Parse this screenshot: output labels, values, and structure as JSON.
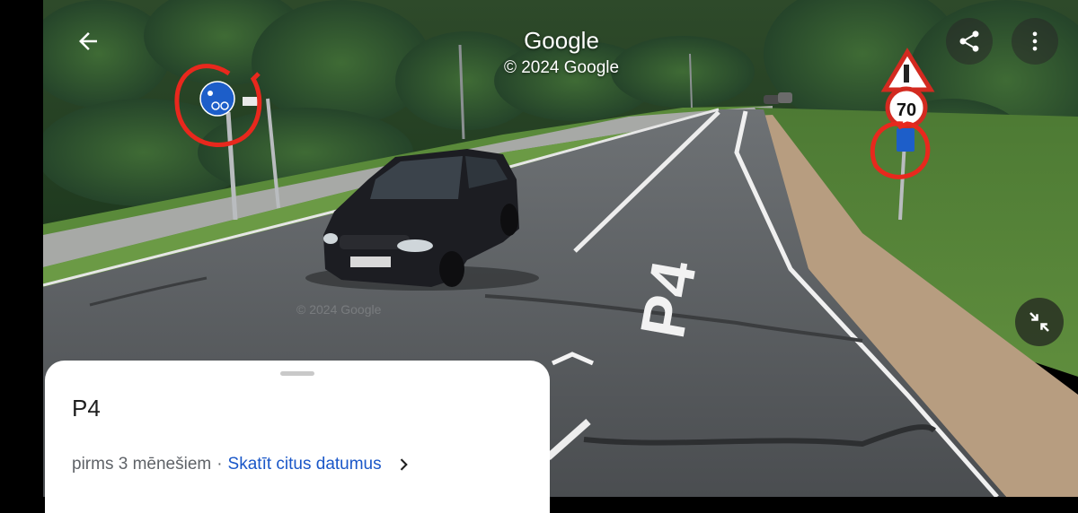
{
  "header": {
    "title": "Google",
    "copyright": "© 2024 Google"
  },
  "icons": {
    "back": "arrow-back",
    "share": "share",
    "more": "more-vert",
    "collapse": "collapse-arrows"
  },
  "scene": {
    "road_marking": "P4",
    "pano_watermark": "© 2024 Google",
    "speed_limit": "70"
  },
  "info_card": {
    "title": "P4",
    "age_text": "pirms 3 mēnešiem",
    "separator": "·",
    "dates_link": "Skatīt citus datumus"
  },
  "colors": {
    "link": "#1a57c8",
    "annotation_circle": "#e8281d",
    "sign_blue": "#1d5ec9"
  }
}
